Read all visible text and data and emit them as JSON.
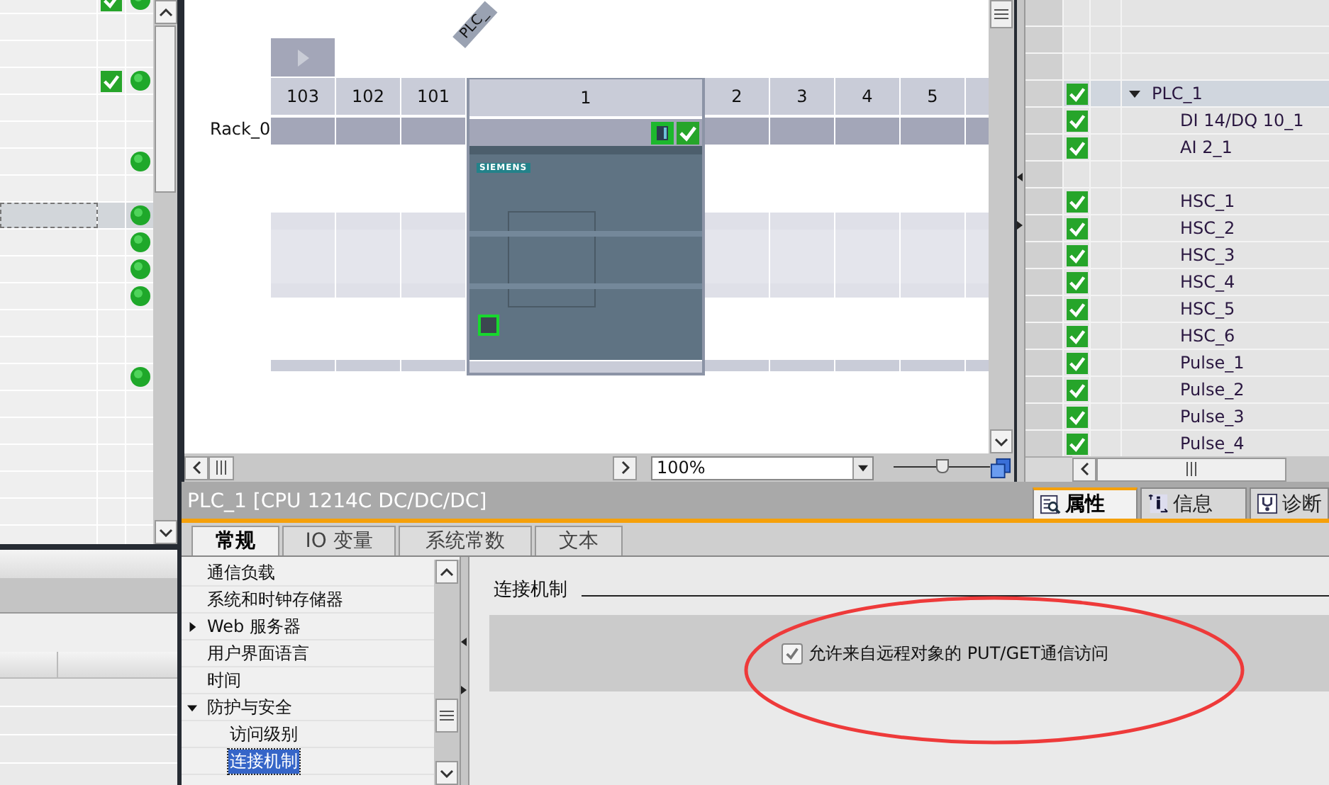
{
  "left_list": {
    "rows": [
      {
        "checked": true,
        "online": true,
        "selected": false
      },
      {
        "checked": false,
        "online": false,
        "selected": false
      },
      {
        "checked": false,
        "online": false,
        "selected": false
      },
      {
        "checked": true,
        "online": true,
        "selected": false
      },
      {
        "checked": false,
        "online": false,
        "selected": false
      },
      {
        "checked": false,
        "online": false,
        "selected": false
      },
      {
        "checked": false,
        "online": true,
        "selected": false
      },
      {
        "checked": false,
        "online": false,
        "selected": false
      },
      {
        "checked": false,
        "online": true,
        "selected": true
      },
      {
        "checked": false,
        "online": true,
        "selected": false
      },
      {
        "checked": false,
        "online": true,
        "selected": false
      },
      {
        "checked": false,
        "online": true,
        "selected": false
      },
      {
        "checked": false,
        "online": false,
        "selected": false
      },
      {
        "checked": false,
        "online": false,
        "selected": false
      },
      {
        "checked": false,
        "online": true,
        "selected": false
      },
      {
        "checked": false,
        "online": false,
        "selected": false
      },
      {
        "checked": false,
        "online": false,
        "selected": false
      },
      {
        "checked": false,
        "online": false,
        "selected": false
      },
      {
        "checked": false,
        "online": false,
        "selected": false
      },
      {
        "checked": false,
        "online": false,
        "selected": false
      },
      {
        "checked": false,
        "online": false,
        "selected": false
      }
    ]
  },
  "canvas": {
    "device_label": "PLC_",
    "rack": {
      "name": "Rack_0",
      "slots": [
        {
          "number": "103"
        },
        {
          "number": "102"
        },
        {
          "number": "101"
        },
        {
          "number": "1",
          "module": {
            "brand": "SIEMENS"
          }
        },
        {
          "number": "2"
        },
        {
          "number": "3"
        },
        {
          "number": "4"
        },
        {
          "number": "5"
        }
      ]
    },
    "zoom": "100%",
    "zoom_slider": {
      "level": 0.5
    }
  },
  "device_tree": {
    "rows": [
      {
        "checked": false
      },
      {
        "checked": false
      },
      {
        "checked": false
      },
      {
        "name": "PLC_1",
        "checked": true,
        "expanded": true,
        "selected": true,
        "children": [
          {
            "name": "DI 14/DQ 10_1",
            "checked": true
          },
          {
            "name": "AI 2_1",
            "checked": true
          },
          {
            "checked": false
          },
          {
            "name": "HSC_1",
            "checked": true
          },
          {
            "name": "HSC_2",
            "checked": true
          },
          {
            "name": "HSC_3",
            "checked": true
          },
          {
            "name": "HSC_4",
            "checked": true
          },
          {
            "name": "HSC_5",
            "checked": true
          },
          {
            "name": "HSC_6",
            "checked": true
          },
          {
            "name": "Pulse_1",
            "checked": true
          },
          {
            "name": "Pulse_2",
            "checked": true
          },
          {
            "name": "Pulse_3",
            "checked": true
          },
          {
            "name": "Pulse_4",
            "checked": true
          }
        ]
      }
    ]
  },
  "inspector": {
    "title": "PLC_1 [CPU 1214C DC/DC/DC]",
    "view_tabs": [
      {
        "label": "属性",
        "kind": "properties",
        "selected": true
      },
      {
        "label": "信息",
        "kind": "info",
        "selected": false
      },
      {
        "label": "诊断",
        "kind": "diagnostics",
        "selected": false
      }
    ],
    "tabs": [
      {
        "label": "常规",
        "selected": true
      },
      {
        "label": "IO 变量",
        "selected": false
      },
      {
        "label": "系统常数",
        "selected": false
      },
      {
        "label": "文本",
        "selected": false
      }
    ],
    "nav": [
      {
        "label": "通信负载",
        "selected": false
      },
      {
        "label": "系统和时钟存储器",
        "selected": false
      },
      {
        "label": "Web 服务器",
        "selected": false,
        "expanded": false
      },
      {
        "label": "用户界面语言",
        "selected": false
      },
      {
        "label": "时间",
        "selected": false
      },
      {
        "label": "防护与安全",
        "selected": false,
        "expanded": true,
        "children": [
          {
            "label": "访问级别",
            "selected": false
          },
          {
            "label": "连接机制",
            "selected": true
          }
        ]
      }
    ],
    "section": {
      "heading": "连接机制",
      "options": [
        {
          "label": "允许来自远程对象的 PUT/GET通信访问",
          "checked": true
        }
      ]
    }
  }
}
